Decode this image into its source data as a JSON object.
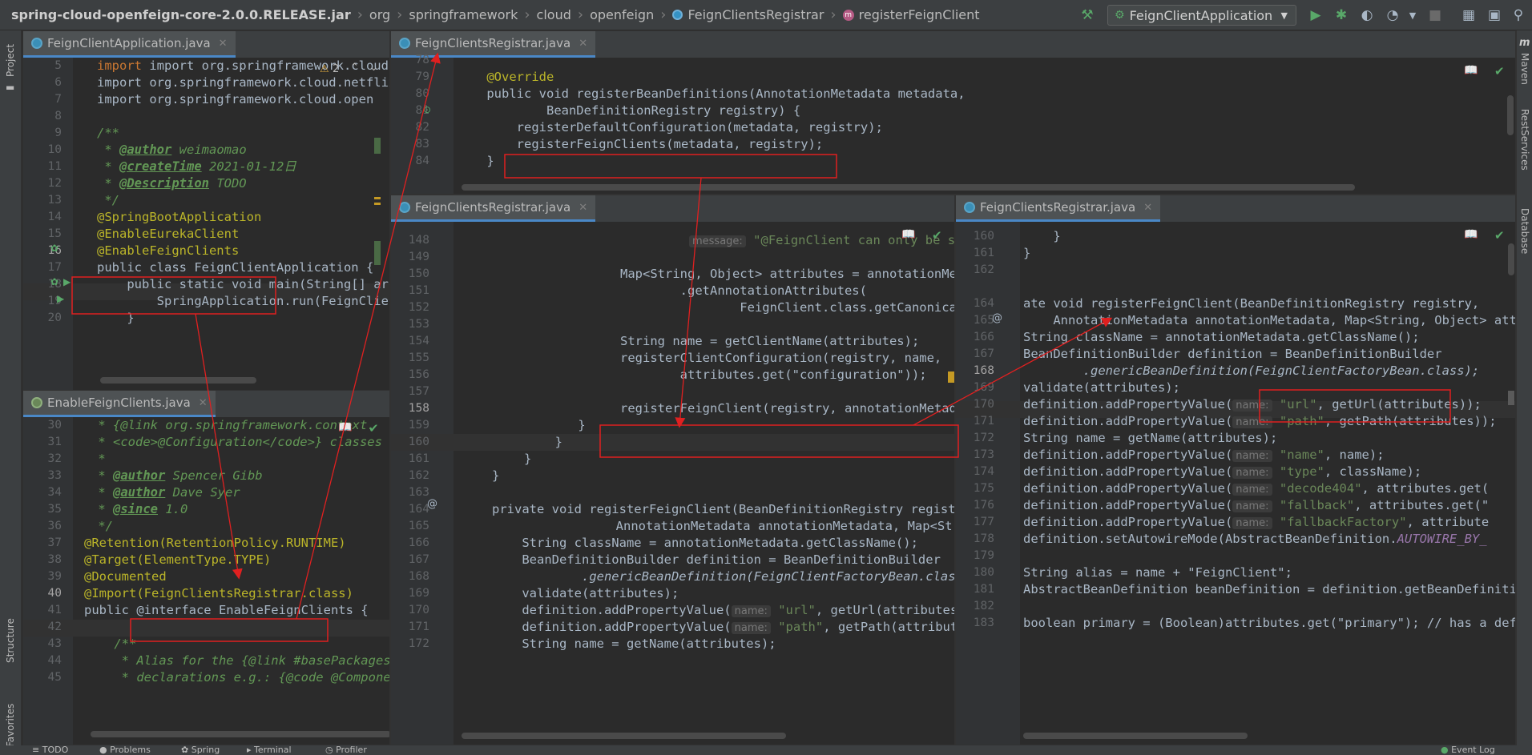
{
  "navbar": {
    "breadcrumbs": [
      {
        "label": "spring-cloud-openfeign-core-2.0.0.RELEASE.jar",
        "icon": "jar"
      },
      {
        "label": "org",
        "icon": "none"
      },
      {
        "label": "springframework",
        "icon": "none"
      },
      {
        "label": "cloud",
        "icon": "none"
      },
      {
        "label": "openfeign",
        "icon": "none"
      },
      {
        "label": "FeignClientsRegistrar",
        "icon": "class-icon"
      },
      {
        "label": "registerFeignClient",
        "icon": "method-icon"
      }
    ],
    "run_config": "FeignClientApplication",
    "icons": [
      "hammer-icon",
      "run-icon",
      "debug-icon",
      "coverage-icon",
      "profile-icon",
      "stop-icon",
      "project-structure-icon",
      "layout-icon"
    ]
  },
  "left_strip": {
    "project": "Project",
    "structure": "Structure",
    "favorites": "Favorites"
  },
  "right_strip": {
    "maven": "Maven",
    "rest": "RestServices",
    "database": "Database"
  },
  "pane_app": {
    "tab": "FeignClientApplication.java",
    "warning_count": "2",
    "lines": [
      {
        "n": "5",
        "t": "import org.springframework.cloud.client."
      },
      {
        "n": "6",
        "t": "import org.springframework.cloud.netflix."
      },
      {
        "n": "7",
        "t": "import org.springframework.cloud.open"
      },
      {
        "n": "8",
        "t": ""
      },
      {
        "n": "9",
        "t": "/**"
      },
      {
        "n": "10",
        "a": "@author",
        "b": " weimaomao"
      },
      {
        "n": "11",
        "a": "@createTime",
        "b": " 2021-01-12日"
      },
      {
        "n": "12",
        "a": "@Description",
        "b": " TODO"
      },
      {
        "n": "13",
        "t": " */"
      },
      {
        "n": "14",
        "t": "@SpringBootApplication"
      },
      {
        "n": "15",
        "t": "@EnableEurekaClient"
      },
      {
        "n": "16",
        "t": "@EnableFeignClients"
      },
      {
        "n": "17",
        "t": "public class FeignClientApplication {"
      },
      {
        "n": "18",
        "t": "    public static void main(String[] args) {"
      },
      {
        "n": "19",
        "t": "        SpringApplication.run(FeignClientApplication.class, args);"
      },
      {
        "n": "20",
        "t": "    }"
      }
    ]
  },
  "pane_enable": {
    "tab": "EnableFeignClients.java",
    "lines": [
      {
        "n": "30",
        "t": " * {@link org.springframework.context."
      },
      {
        "n": "31",
        "t": " * <code>@Configuration</code>} classes"
      },
      {
        "n": "32",
        "t": " *"
      },
      {
        "n": "33",
        "a": "@author",
        "b": " Spencer Gibb"
      },
      {
        "n": "34",
        "a": "@author",
        "b": " Dave Syer"
      },
      {
        "n": "35",
        "a": "@since",
        "b": " 1.0"
      },
      {
        "n": "36",
        "t": " */"
      },
      {
        "n": "37",
        "t": "@Retention(RetentionPolicy.RUNTIME)"
      },
      {
        "n": "38",
        "t": "@Target(ElementType.TYPE)"
      },
      {
        "n": "39",
        "t": "@Documented"
      },
      {
        "n": "40",
        "t": "@Import(FeignClientsRegistrar.class)"
      },
      {
        "n": "41",
        "t": "public @interface EnableFeignClients {"
      },
      {
        "n": "42",
        "t": ""
      },
      {
        "n": "43",
        "t": "    /**"
      },
      {
        "n": "44",
        "t": "     * Alias for the {@link #basePackages}"
      },
      {
        "n": "45",
        "t": "     * declarations e.g.: {@code @ComponentScan"
      }
    ]
  },
  "pane_top": {
    "tab": "FeignClientsRegistrar.java",
    "lines": [
      {
        "n": "78",
        "t": ""
      },
      {
        "n": "79",
        "t": "    @Override"
      },
      {
        "n": "80",
        "t": "    public void registerBeanDefinitions(AnnotationMetadata metadata,"
      },
      {
        "n": "81",
        "t": "            BeanDefinitionRegistry registry) {"
      },
      {
        "n": "82",
        "t": "        registerDefaultConfiguration(metadata, registry);"
      },
      {
        "n": "83",
        "t": "        registerFeignClients(metadata, registry);"
      },
      {
        "n": "84",
        "t": "    }"
      }
    ]
  },
  "pane_mid": {
    "tab": "FeignClientsRegistrar.java",
    "hint_message": "message:",
    "lines": [
      {
        "n": "148",
        "t": "\"@FeignClient can only be specified on an interface\");"
      },
      {
        "n": "149",
        "t": ""
      },
      {
        "n": "150",
        "t": "Map<String, Object> attributes = annotationMetadata"
      },
      {
        "n": "151",
        "t": "        .getAnnotationAttributes("
      },
      {
        "n": "152",
        "t": "                FeignClient.class.getCanonicalName());"
      },
      {
        "n": "153",
        "t": ""
      },
      {
        "n": "154",
        "t": "String name = getClientName(attributes);"
      },
      {
        "n": "155",
        "t": "registerClientConfiguration(registry, name,"
      },
      {
        "n": "156",
        "t": "        attributes.get(\"configuration\"));"
      },
      {
        "n": "157",
        "t": ""
      },
      {
        "n": "158",
        "t": "registerFeignClient(registry, annotationMetadata, attributes);"
      },
      {
        "n": "159",
        "t": "    }"
      },
      {
        "n": "160",
        "t": "  }"
      },
      {
        "n": "161",
        "t": "}"
      },
      {
        "n": "162",
        "t": "}"
      },
      {
        "n": "163",
        "t": ""
      },
      {
        "n": "164",
        "t": "private void registerFeignClient(BeanDefinitionRegistry registry,"
      },
      {
        "n": "165",
        "t": "        AnnotationMetadata annotationMetadata, Map<String, Object> attributes) {"
      },
      {
        "n": "166",
        "t": "    String className = annotationMetadata.getClassName();"
      },
      {
        "n": "167",
        "t": "    BeanDefinitionBuilder definition = BeanDefinitionBuilder"
      },
      {
        "n": "168",
        "t": "            .genericBeanDefinition(FeignClientFactoryBean.class);"
      },
      {
        "n": "169",
        "t": "    validate(attributes);"
      },
      {
        "n": "170",
        "t": "    definition.addPropertyValue("
      },
      {
        "n": "171",
        "t": "    definition.addPropertyValue("
      },
      {
        "n": "172",
        "t": "    String name = getName(attributes);"
      }
    ],
    "hint_name": "name:"
  },
  "pane_right": {
    "tab": "FeignClientsRegistrar.java",
    "lines": [
      {
        "n": "160",
        "t": "    }"
      },
      {
        "n": "161",
        "t": "}"
      },
      {
        "n": "162",
        "t": ""
      },
      {
        "n": "164",
        "t": "ate void registerFeignClient(BeanDefinitionRegistry registry,"
      },
      {
        "n": "165",
        "t": "    AnnotationMetadata annotationMetadata, Map<String, Object> attributes) {"
      },
      {
        "n": "166",
        "t": "String className = annotationMetadata.getClassName();"
      },
      {
        "n": "167",
        "t": "BeanDefinitionBuilder definition = BeanDefinitionBuilder"
      },
      {
        "n": "168",
        "t": "        .genericBeanDefinition(FeignClientFactoryBean.class);"
      },
      {
        "n": "169",
        "t": "validate(attributes);"
      },
      {
        "n": "170",
        "t": "definition.addPropertyValue("
      },
      {
        "n": "171",
        "t": "definition.addPropertyValue("
      },
      {
        "n": "172",
        "t": "String name = getName(attributes);"
      },
      {
        "n": "173",
        "t": "definition.addPropertyValue("
      },
      {
        "n": "174",
        "t": "definition.addPropertyValue("
      },
      {
        "n": "175",
        "t": "definition.addPropertyValue("
      },
      {
        "n": "176",
        "t": "definition.addPropertyValue("
      },
      {
        "n": "177",
        "t": "definition.addPropertyValue("
      },
      {
        "n": "178",
        "t": "definition.setAutowireMode(AbstractBeanDefinition."
      },
      {
        "n": "179",
        "t": ""
      },
      {
        "n": "180",
        "t": "String alias = name + \"FeignClient\";"
      },
      {
        "n": "181",
        "t": "AbstractBeanDefinition beanDefinition = definition.getBeanDefinition();"
      },
      {
        "n": "182",
        "t": ""
      },
      {
        "n": "183",
        "t": "boolean primary = (Boolean)attributes.get(\"primary\"); // has a default, won't be null"
      }
    ]
  },
  "bottombar": {
    "todo": "TODO",
    "problems": "Problems",
    "spring": "Spring",
    "terminal": "Terminal",
    "profiler": "Profiler",
    "event_log": "Event Log"
  },
  "colors": {
    "bg": "#2b2b2b",
    "keyword": "#cc7832",
    "annotation": "#bbb529",
    "string": "#6a8759",
    "function": "#ffc66d",
    "highlight": "#214283",
    "annotation_box": "#e02020"
  }
}
